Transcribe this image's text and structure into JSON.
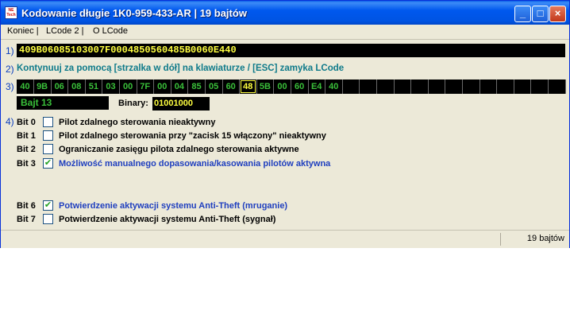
{
  "window": {
    "title": "Kodowanie długie  1K0-959-433-AR | 19 bajtów",
    "icon_text": "NE Tech",
    "buttons": {
      "minimize": "_",
      "maximize": "□",
      "close": "×"
    }
  },
  "menu": [
    "Koniec |",
    "LCode 2 |",
    "O LCode"
  ],
  "labels": {
    "s1": "1)",
    "s2": "2)",
    "s3": "3)",
    "s4": "4)"
  },
  "coding_hex": "409B06085103007F0004850560485B0060E440",
  "info_text": "Kontynuuj za pomocą [strzalka w dół] na klawiaturze / [ESC] zamyka LCode",
  "bytes": [
    "40",
    "9B",
    "06",
    "08",
    "51",
    "03",
    "00",
    "7F",
    "00",
    "04",
    "85",
    "05",
    "60",
    "48",
    "5B",
    "00",
    "60",
    "E4",
    "40",
    "",
    "",
    "",
    "",
    "",
    "",
    "",
    "",
    "",
    "",
    "",
    "",
    ""
  ],
  "active_byte_index": 13,
  "byte_selected": "Bajt 13",
  "binary_label": "Binary:",
  "binary_value": "01001000",
  "bits": [
    {
      "label": "Bit 0",
      "checked": false,
      "text": "Pilot zdalnego sterowania nieaktywny"
    },
    {
      "label": "Bit 1",
      "checked": false,
      "text": "Pilot zdalnego sterowania przy \"zacisk 15 włączony\" nieaktywny"
    },
    {
      "label": "Bit 2",
      "checked": false,
      "text": "Ograniczanie zasięgu pilota zdalnego sterowania aktywne"
    },
    {
      "label": "Bit 3",
      "checked": true,
      "text": "Możliwość manualnego dopasowania/kasowania pilotów aktywna"
    },
    {
      "label": "Bit 6",
      "checked": true,
      "text": "Potwierdzenie aktywacji systemu Anti-Theft (mruganie)"
    },
    {
      "label": "Bit 7",
      "checked": false,
      "text": "Potwierdzenie aktywacji systemu Anti-Theft (sygnał)"
    }
  ],
  "status": {
    "right": "19 bajtów"
  },
  "colors": {
    "titlebar": "#0054e3",
    "hex_text": "#ffff40",
    "byte_text": "#3ac03a",
    "info_text": "#0e7a8a",
    "checked_text": "#1f3fbf"
  }
}
